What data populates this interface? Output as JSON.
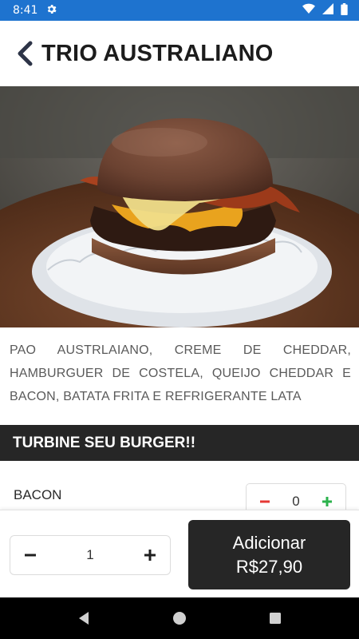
{
  "status_bar": {
    "time": "8:41",
    "background_color": "#1e73cf",
    "icons": [
      "gear-icon",
      "wifi-icon",
      "signal-icon",
      "battery-icon"
    ]
  },
  "header": {
    "title": "TRIO AUSTRALIANO",
    "back_icon": "chevron-left-icon"
  },
  "product": {
    "image": "burger-photo",
    "description": "PAO AUSTRLAIANO, CREME DE CHEDDAR, HAMBURGUER DE COSTELA, QUEIJO CHEDDAR E BACON, BATATA FRITA E REFRIGERANTE LATA"
  },
  "extras": {
    "section_title": "TURBINE SEU BURGER!!",
    "items": [
      {
        "label": "BACON",
        "count": "0",
        "minus_color": "#e53935",
        "plus_color": "#2bb24c"
      }
    ]
  },
  "footer": {
    "quantity": "1",
    "add_label": "Adicionar",
    "add_price": "R$27,90",
    "button_color": "#262626"
  },
  "nav": {
    "icons": [
      "back-triangle-icon",
      "home-circle-icon",
      "recents-square-icon"
    ]
  }
}
